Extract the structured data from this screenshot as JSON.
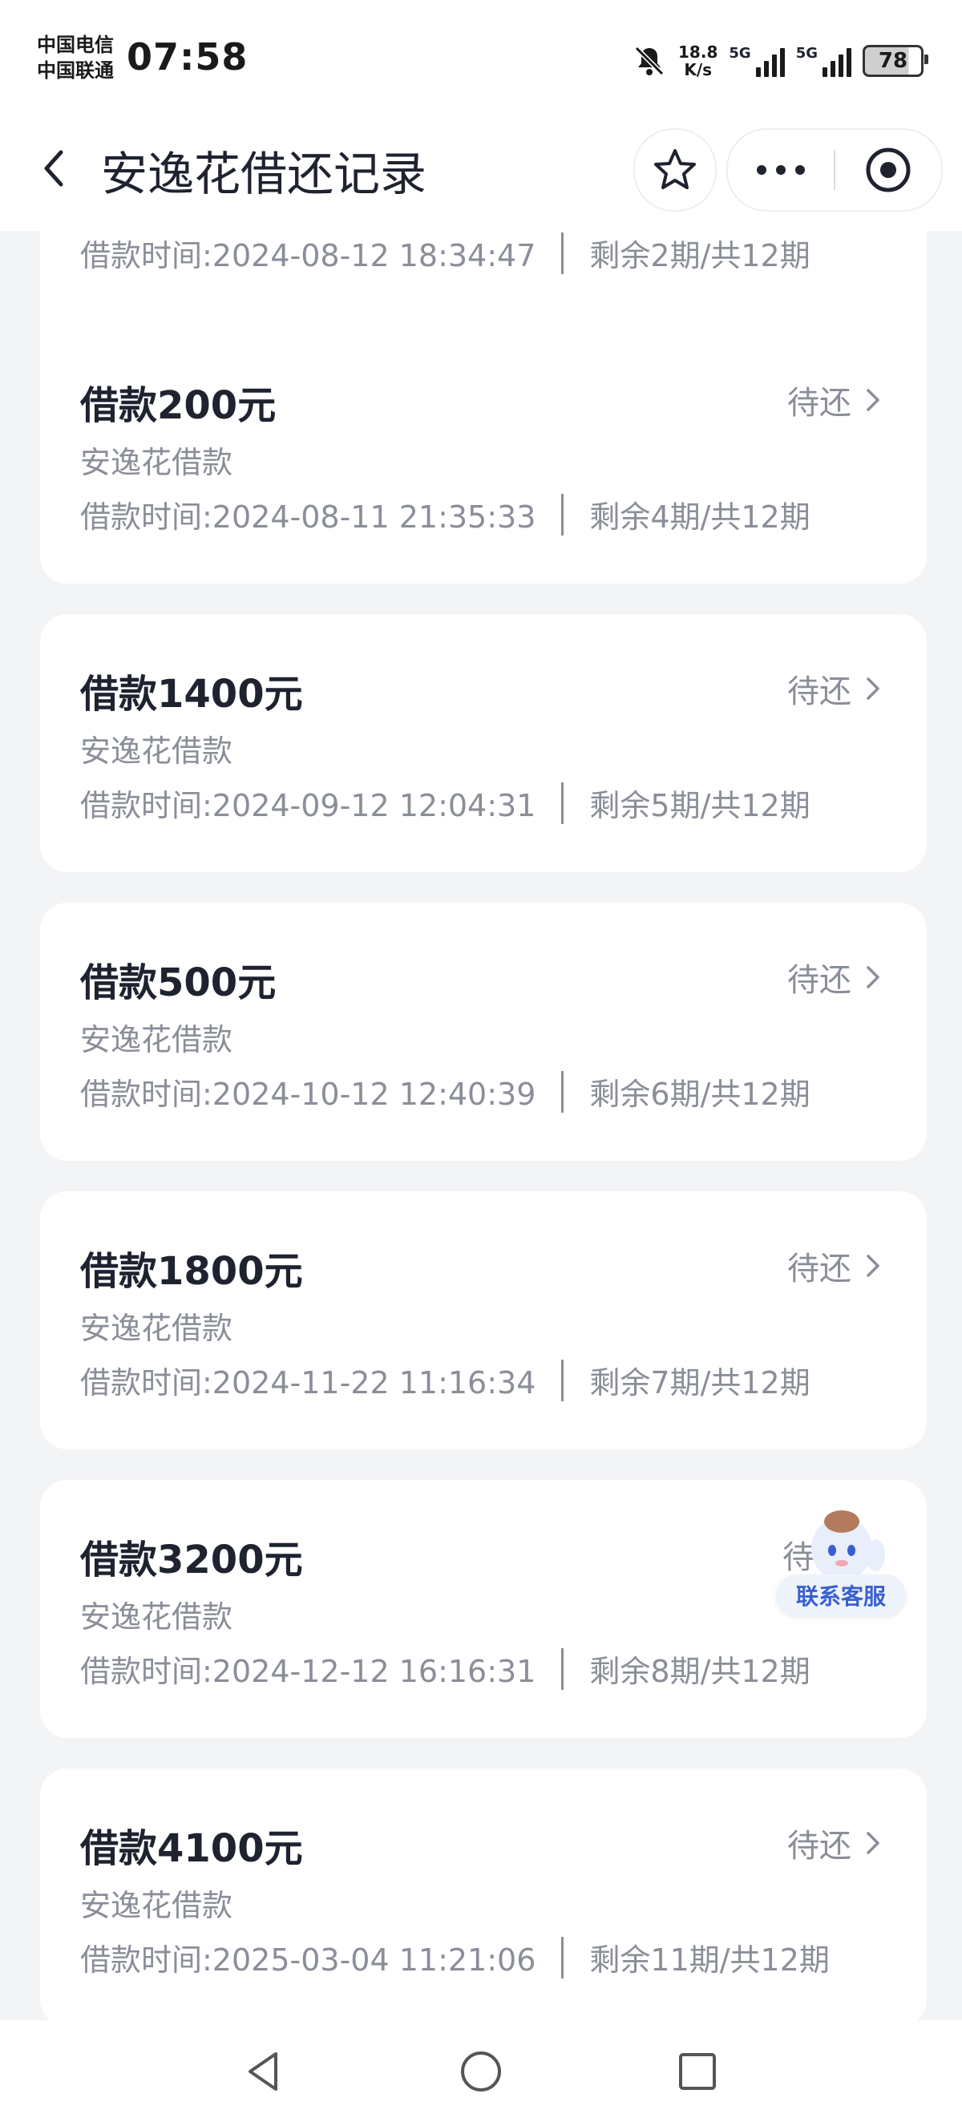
{
  "status_bar": {
    "carrier1": "中国电信",
    "carrier2": "中国联通",
    "time": "07:58",
    "speed_value": "18.8",
    "speed_unit": "K/s",
    "net1": "5G",
    "net2": "5G",
    "battery": "78"
  },
  "header": {
    "title": "安逸花借还记录"
  },
  "partial_card": {
    "meta_time": "借款时间:2024-08-12 18:34:47",
    "meta_term": "剩余2期/共12期"
  },
  "loans": [
    {
      "amount": "借款200元",
      "product": "安逸花借款",
      "time": "借款时间:2024-08-11 21:35:33",
      "term": "剩余4期/共12期",
      "status": "待还"
    },
    {
      "amount": "借款1400元",
      "product": "安逸花借款",
      "time": "借款时间:2024-09-12 12:04:31",
      "term": "剩余5期/共12期",
      "status": "待还"
    },
    {
      "amount": "借款500元",
      "product": "安逸花借款",
      "time": "借款时间:2024-10-12 12:40:39",
      "term": "剩余6期/共12期",
      "status": "待还"
    },
    {
      "amount": "借款1800元",
      "product": "安逸花借款",
      "time": "借款时间:2024-11-22 11:16:34",
      "term": "剩余7期/共12期",
      "status": "待还"
    },
    {
      "amount": "借款3200元",
      "product": "安逸花借款",
      "time": "借款时间:2024-12-12 16:16:31",
      "term": "剩余8期/共12期",
      "status": "待"
    },
    {
      "amount": "借款4100元",
      "product": "安逸花借款",
      "time": "借款时间:2025-03-04 11:21:06",
      "term": "剩余11期/共12期",
      "status": "待还"
    }
  ],
  "customer_service": {
    "label": "联系客服"
  },
  "colors": {
    "accent": "#3a5fd0",
    "text_primary": "#1f2330",
    "text_secondary": "#8a8e98",
    "background": "#f3f4f6"
  }
}
